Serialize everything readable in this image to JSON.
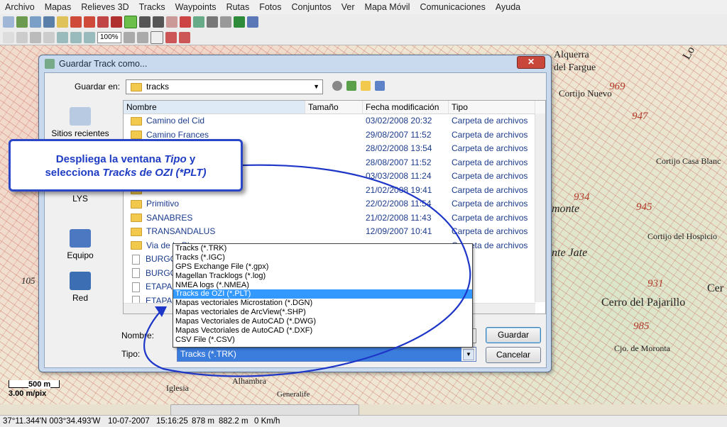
{
  "menu": [
    "Archivo",
    "Mapas",
    "Relieves 3D",
    "Tracks",
    "Waypoints",
    "Rutas",
    "Fotos",
    "Conjuntos",
    "Ver",
    "Mapa Móvil",
    "Comunicaciones",
    "Ayuda"
  ],
  "toolbar": {
    "zoom_value": "100%",
    "zoom_small": "100%"
  },
  "map": {
    "labels": [
      "Alquerra",
      "del Fargue",
      "Cortijo Nuevo",
      "Cortijo Casa Blanc",
      "monte",
      "Cortijo del Hospicio",
      "nte Jate",
      "Cer",
      "Cerro del Pajarillo",
      "Cjo. de Moronta",
      "Iglesia",
      "Alhambra",
      "Generalife",
      "LYS",
      "Lo"
    ],
    "numbers": [
      "969",
      "947",
      "934",
      "945",
      "931",
      "985",
      "105"
    ]
  },
  "dialog": {
    "title": "Guardar Track como...",
    "close": "✕",
    "save_in_label": "Guardar en:",
    "save_in_value": "tracks",
    "places": [
      "Sitios recientes",
      "LYS",
      "Equipo",
      "Red"
    ],
    "columns": [
      "Nombre",
      "Tamaño",
      "Fecha modificación",
      "Tipo"
    ],
    "rows": [
      {
        "name": "Camino del Cid",
        "date": "03/02/2008 20:32",
        "type": "Carpeta de archivos"
      },
      {
        "name": "Camino Frances",
        "date": "29/08/2007 11:52",
        "type": "Carpeta de archivos"
      },
      {
        "name": "",
        "date": "28/02/2008 13:54",
        "type": "Carpeta de archivos"
      },
      {
        "name": "",
        "date": "28/08/2007 11:52",
        "type": "Carpeta de archivos"
      },
      {
        "name": "",
        "date": "03/03/2008 11:24",
        "type": "Carpeta de archivos"
      },
      {
        "name": "",
        "date": "21/02/2008 19:41",
        "type": "Carpeta de archivos"
      },
      {
        "name": "Primitivo",
        "date": "22/02/2008 11:54",
        "type": "Carpeta de archivos"
      },
      {
        "name": "SANABRES",
        "date": "21/02/2008 11:43",
        "type": "Carpeta de archivos"
      },
      {
        "name": "TRANSANDALUS",
        "date": "12/09/2007 10:41",
        "type": "Carpeta de archivos"
      },
      {
        "name": "Via de la Pl",
        "date": "",
        "type": "Carpeta de archivos"
      },
      {
        "name": "BURGOS-",
        "date": "",
        "type": "rack"
      },
      {
        "name": "BURGOS-",
        "date": "",
        "type": "rack"
      },
      {
        "name": "ETAPA 02",
        "date": "",
        "type": "rack"
      },
      {
        "name": "ETAPA 02",
        "date": "",
        "type": "rack"
      }
    ],
    "name_label": "Nombre:",
    "type_label": "Tipo:",
    "type_value": "Tracks (*.TRK)",
    "save_button": "Guardar",
    "cancel_button": "Cancelar"
  },
  "dropdown": {
    "options": [
      "Tracks (*.TRK)",
      "Tracks (*.IGC)",
      "GPS Exchange File (*.gpx)",
      "Magellan Tracklogs (*.log)",
      "NMEA logs (*.NMEA)",
      "Tracks de OZI (*.PLT)",
      "Mapas vectoriales Microstation (*.DGN)",
      "Mapas vectoriales de ArcView(*.SHP)",
      "Mapas Vectoriales de AutoCAD (*.DWG)",
      "Mapas Vectoriales de AutoCAD (*.DXF)",
      "CSV File (*.CSV)"
    ],
    "selected_index": 5
  },
  "callout": {
    "line1_a": "Despliega la ventana ",
    "line1_em": "Tipo",
    "line1_b": " y",
    "line2_a": "selecciona ",
    "line2_em": "Tracks de OZI (*PLT)"
  },
  "scale": {
    "dist": "500 m",
    "pix": "3.00 m/pix"
  },
  "status": {
    "coords": "37°11.344'N 003°34.493'W",
    "date": "10-07-2007",
    "time": "15:16:25",
    "alt": "878 m",
    "dist": "882.2 m",
    "speed": "0 Km/h"
  },
  "colors": {
    "accent": "#2b47c8",
    "selection": "#3399ff",
    "link": "#1b3b8c"
  }
}
